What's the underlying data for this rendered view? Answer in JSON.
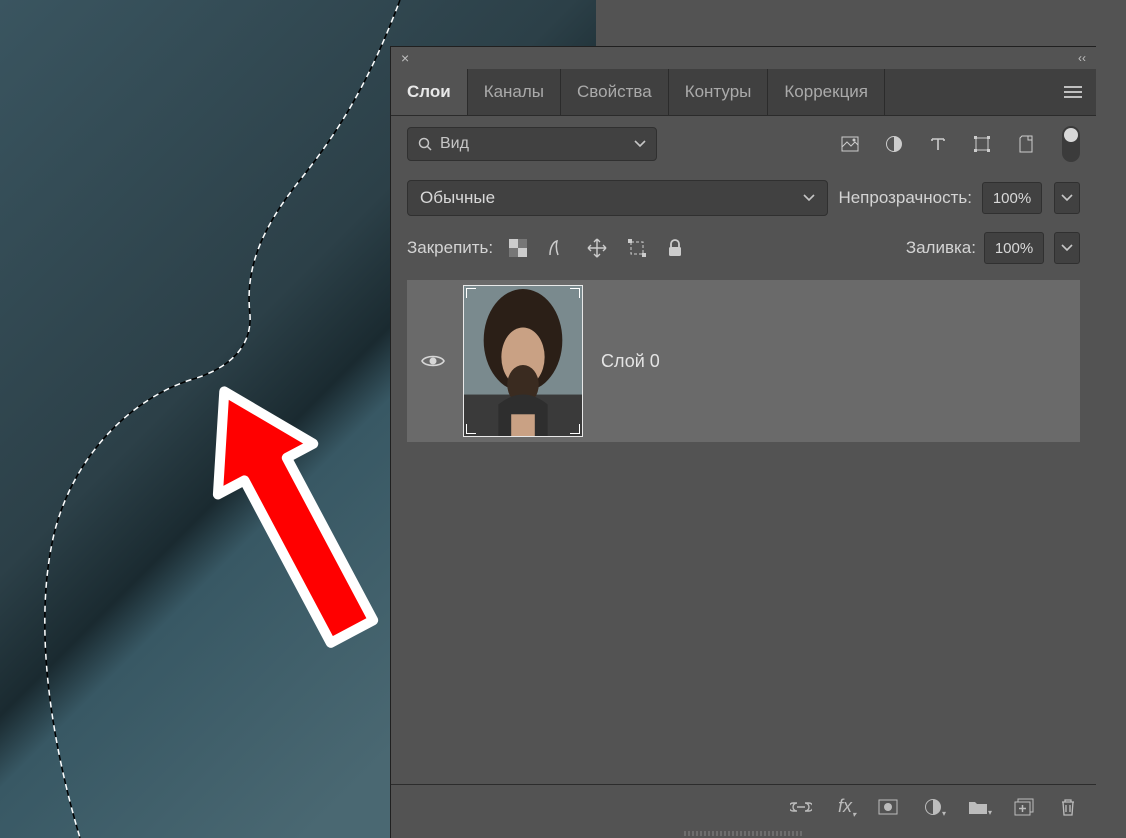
{
  "tabs": {
    "layers": "Слои",
    "channels": "Каналы",
    "properties": "Свойства",
    "paths": "Контуры",
    "adjustments": "Коррекция"
  },
  "search": {
    "placeholder": "Вид"
  },
  "blend": {
    "mode": "Обычные",
    "opacity_label": "Непрозрачность:",
    "opacity_value": "100%"
  },
  "lock": {
    "label": "Закрепить:",
    "fill_label": "Заливка:",
    "fill_value": "100%"
  },
  "layers": [
    {
      "name": "Слой 0"
    }
  ],
  "bottom_icons": {
    "fx": "fx"
  }
}
